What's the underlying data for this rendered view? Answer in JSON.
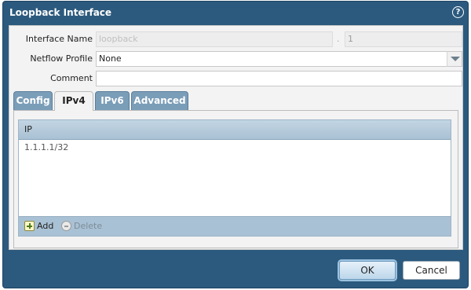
{
  "dialog": {
    "title": "Loopback Interface",
    "help_icon_glyph": "?"
  },
  "form": {
    "interface_name_label": "Interface Name",
    "interface_name_value": "loopback",
    "separator": ".",
    "interface_suffix_value": "1",
    "netflow_profile_label": "Netflow Profile",
    "netflow_profile_value": "None",
    "comment_label": "Comment",
    "comment_value": ""
  },
  "tabs": [
    {
      "label": "Config",
      "active": false
    },
    {
      "label": "IPv4",
      "active": true
    },
    {
      "label": "IPv6",
      "active": false
    },
    {
      "label": "Advanced",
      "active": false
    }
  ],
  "ip_table": {
    "column_header": "IP",
    "rows": [
      "1.1.1.1/32"
    ],
    "add_label": "Add",
    "delete_label": "Delete"
  },
  "footer": {
    "ok_label": "OK",
    "cancel_label": "Cancel"
  },
  "colors": {
    "title_bar": "#2c5a7e",
    "tab_inactive": "#7a9db8",
    "grid_header": "#a9c1d4"
  }
}
